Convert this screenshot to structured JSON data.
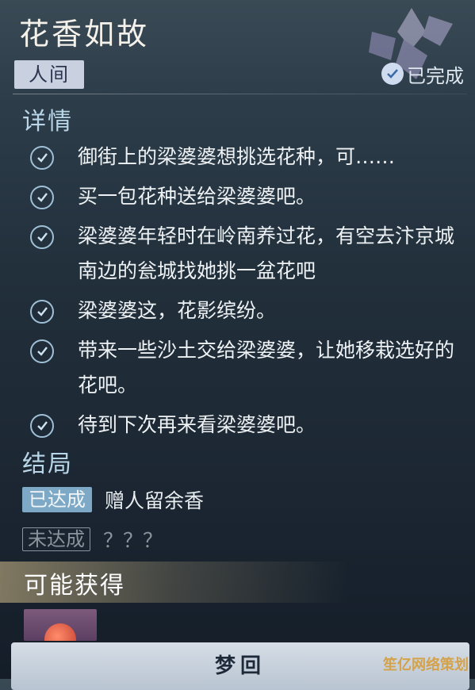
{
  "quest": {
    "title": "花香如故",
    "tag": "人间",
    "status": "已完成"
  },
  "details": {
    "label": "详情",
    "items": [
      "御街上的梁婆婆想挑选花种，可……",
      "买一包花种送给梁婆婆吧。",
      "梁婆婆年轻时在岭南养过花，有空去汴京城南边的瓮城找她挑一盆花吧",
      "梁婆婆这，花影缤纷。",
      "带来一些沙土交给梁婆婆，让她移栽选好的花吧。",
      "待到下次再来看梁婆婆吧。"
    ]
  },
  "endings": {
    "label": "结局",
    "achieved_badge": "已达成",
    "achieved_text": "赠人留余香",
    "unachieved_badge": "未达成",
    "unachieved_text": "？？？"
  },
  "rewards": {
    "label": "可能获得"
  },
  "action": {
    "label": "梦回"
  },
  "watermark": "笙亿网络策划",
  "colors": {
    "accent": "#7ea9c6",
    "check": "#9fc0d6"
  }
}
